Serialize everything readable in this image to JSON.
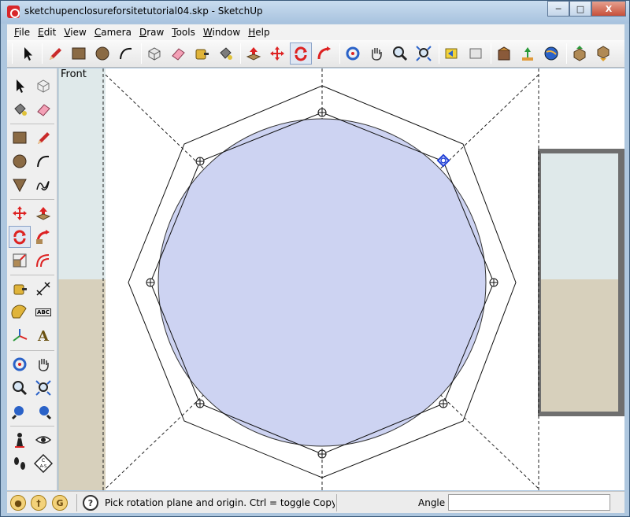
{
  "window": {
    "title": "sketchupenclosureforsitetutorial04.skp - SketchUp",
    "minimize_glyph": "─",
    "maximize_glyph": "□",
    "close_glyph": "X"
  },
  "menubar": {
    "items": [
      {
        "letter": "F",
        "rest": "ile"
      },
      {
        "letter": "E",
        "rest": "dit"
      },
      {
        "letter": "V",
        "rest": "iew"
      },
      {
        "letter": "C",
        "rest": "amera"
      },
      {
        "letter": "D",
        "rest": "raw"
      },
      {
        "letter": "T",
        "rest": "ools"
      },
      {
        "letter": "W",
        "rest": "indow"
      },
      {
        "letter": "H",
        "rest": "elp"
      }
    ]
  },
  "viewport": {
    "scene_label": "Front",
    "colors": {
      "circle_fill": "#cdd3f2",
      "ground": "#d7d0bc",
      "sky": "#dfe9ea",
      "cursor": "#1f3fd6"
    }
  },
  "toolbar": {
    "tools": [
      "select-tool",
      "pencil-tool",
      "rectangle-tool",
      "circle-tool",
      "arc-tool",
      "make-component-tool",
      "eraser-tool",
      "tape-measure-tool",
      "paint-bucket-tool",
      "push-pull-tool",
      "move-tool",
      "rotate-tool",
      "follow-me-tool",
      "orbit-tool",
      "pan-tool",
      "zoom-tool",
      "zoom-extents-tool",
      "previous-view-tool",
      "next-view-tool",
      "get-models-tool",
      "share-model-tool",
      "google-earth-tool",
      "component-up-tool",
      "component-down-tool"
    ]
  },
  "left_toolbar": {
    "tools": [
      "select-tool",
      "make-component-tool",
      "paint-bucket-tool",
      "eraser-tool",
      "rectangle-tool",
      "line-tool",
      "circle-tool",
      "arc-tool",
      "polygon-tool",
      "freehand-tool",
      "move-tool",
      "push-pull-tool",
      "rotate-tool",
      "follow-me-tool",
      "scale-tool",
      "offset-tool",
      "tape-measure-tool",
      "dimension-tool",
      "protractor-tool",
      "text-tool",
      "axes-tool",
      "3d-text-tool",
      "orbit-tool",
      "pan-tool",
      "zoom-tool",
      "zoom-window-tool",
      "previous-tool",
      "next-tool",
      "position-camera-tool",
      "look-around-tool",
      "walk-tool",
      "section-plane-tool"
    ],
    "text_label_icon": "ABC",
    "letter_a": "A",
    "section_label": "C",
    "section_label2": "A-S"
  },
  "statusbar": {
    "hint": "Pick rotation plane and origin.  Ctrl = toggle Copy",
    "vcb_label": "Angle",
    "vcb_value": "",
    "geo_glyph": "●",
    "credits_glyph": "†",
    "signin_glyph": "G",
    "help_glyph": "?"
  }
}
